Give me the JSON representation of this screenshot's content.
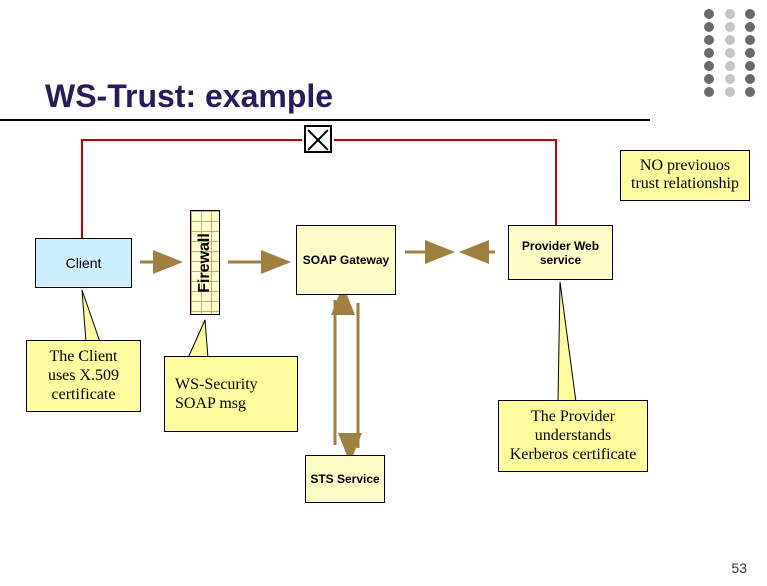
{
  "title": "WS-Trust: example",
  "boxes": {
    "client": "Client",
    "firewall": "Firewall",
    "soap_gateway": "SOAP Gateway",
    "provider": "Provider Web service",
    "sts": "STS Service"
  },
  "callouts": {
    "no_trust": "NO previouos trust relationship",
    "client_cert": "The Client uses X.509 certificate",
    "ws_security": "WS-Security SOAP msg",
    "provider_kerberos": "The Provider understands Kerberos certificate"
  },
  "page_number": "53"
}
